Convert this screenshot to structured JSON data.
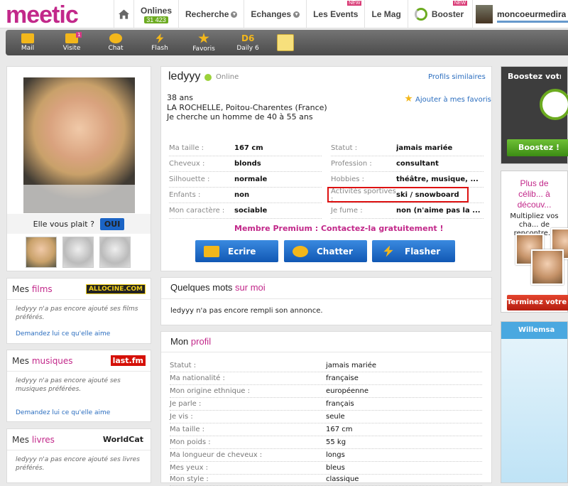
{
  "brand": {
    "logo": "meetic"
  },
  "topnav": {
    "onlines_label": "Onlines",
    "onlines_count": "31 423",
    "recherche": "Recherche",
    "echanges": "Echanges",
    "events": "Les Events",
    "new_tag": "NEW",
    "mag": "Le Mag",
    "booster": "Booster",
    "username": "moncoeurmedira"
  },
  "toolbar": {
    "items": [
      "Mail",
      "Visite",
      "Chat",
      "Flash",
      "Favoris",
      "Daily 6"
    ],
    "visite_badge": "1",
    "daily_icon": "D6"
  },
  "profile": {
    "name": "ledyyy",
    "status": "Online",
    "similar": "Profils similaires",
    "age": "38 ans",
    "location": "LA ROCHELLE, Poitou-Charentes (France)",
    "seeking": "Je cherche un homme de 40 à 55 ans",
    "add_fav": "Ajouter à mes favoris",
    "like_question": "Elle vous plait ?",
    "like_btn": "OUI",
    "attrs_left": [
      {
        "k": "Ma taille :",
        "v": "167 cm"
      },
      {
        "k": "Cheveux :",
        "v": "blonds"
      },
      {
        "k": "Silhouette :",
        "v": "normale"
      },
      {
        "k": "Enfants :",
        "v": "non"
      },
      {
        "k": "Mon caractère :",
        "v": "sociable"
      }
    ],
    "attrs_right": [
      {
        "k": "Statut :",
        "v": "jamais mariée"
      },
      {
        "k": "Profession :",
        "v": "consultant"
      },
      {
        "k": "Hobbies :",
        "v": "théâtre, musique, ..."
      },
      {
        "k": "Activités sportives :",
        "v": "ski / snowboard"
      },
      {
        "k": "Je fume :",
        "v": "non (n'aime pas la ..."
      }
    ],
    "premium": "Membre Premium : Contactez-la gratuitement !",
    "actions": [
      "Ecrire",
      "Chatter",
      "Flasher"
    ]
  },
  "about": {
    "title_a": "Quelques mots ",
    "title_b": "sur moi",
    "text": "ledyyy n'a pas encore rempli son annonce."
  },
  "monprofil": {
    "title_a": "Mon ",
    "title_b": "profil",
    "rows": [
      {
        "k": "Statut :",
        "v": "jamais mariée"
      },
      {
        "k": "Ma nationalité :",
        "v": "française"
      },
      {
        "k": "Mon origine ethnique :",
        "v": "européenne"
      },
      {
        "k": "Je parle :",
        "v": "français"
      },
      {
        "k": "Je vis :",
        "v": "seule"
      },
      {
        "k": "Ma taille :",
        "v": "167 cm"
      },
      {
        "k": "Mon poids :",
        "v": "55 kg"
      },
      {
        "k": "Ma longueur de cheveux :",
        "v": "longs"
      },
      {
        "k": "Mes yeux :",
        "v": "bleus"
      },
      {
        "k": "Mon style :",
        "v": "classique"
      }
    ]
  },
  "sidebar": {
    "films": {
      "a": "Mes ",
      "b": "films",
      "logo": "ALLOCINE.COM",
      "text": "ledyyy n'a pas encore ajouté ses films préférés.",
      "link": "Demandez lui ce qu'elle aime"
    },
    "musiques": {
      "a": "Mes ",
      "b": "musiques",
      "logo": "last.fm",
      "text": "ledyyy n'a pas encore ajouté ses musiques préférées.",
      "link": "Demandez lui ce qu'elle aime"
    },
    "livres": {
      "a": "Mes ",
      "b": "livres",
      "logo": "WorldCat",
      "text": "ledyyy n'a pas encore ajouté ses livres préférés."
    }
  },
  "ads": {
    "boost_title": "Boostez votre vis... en quelques sec...",
    "boost_btn": "Boostez !",
    "celib_title": "Plus de célib... à découv...",
    "celib_sub": "Multipliez vos cha... de rencontre...",
    "celib_btn": "Terminez votre te...",
    "willemsa": "Willemsa"
  }
}
